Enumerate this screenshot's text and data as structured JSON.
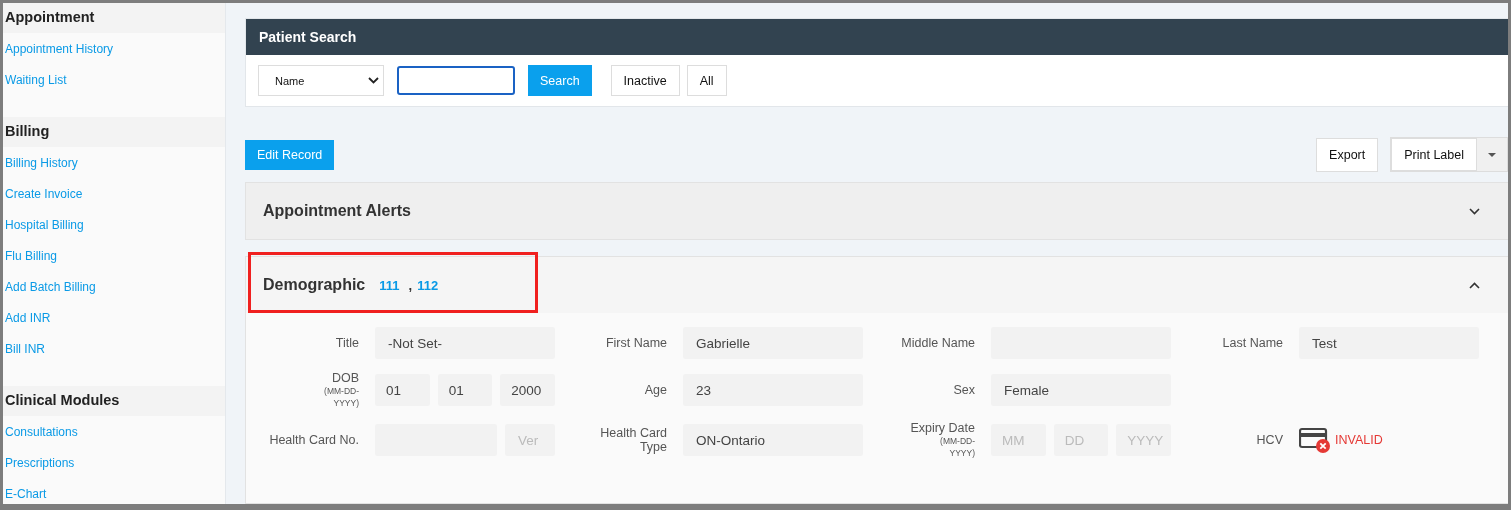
{
  "sidebar": {
    "sections": [
      {
        "title": "Appointment",
        "items": [
          {
            "label": "Appointment History"
          },
          {
            "label": "Waiting List"
          }
        ]
      },
      {
        "title": "Billing",
        "items": [
          {
            "label": "Billing History"
          },
          {
            "label": "Create Invoice"
          },
          {
            "label": "Hospital Billing"
          },
          {
            "label": "Flu Billing"
          },
          {
            "label": "Add Batch Billing"
          },
          {
            "label": "Add INR"
          },
          {
            "label": "Bill INR"
          }
        ]
      },
      {
        "title": "Clinical Modules",
        "items": [
          {
            "label": "Consultations"
          },
          {
            "label": "Prescriptions"
          },
          {
            "label": "E-Chart"
          }
        ]
      }
    ]
  },
  "patient_search": {
    "title": "Patient Search",
    "select": "Name",
    "input": {
      "focused": true
    },
    "buttons": [
      {
        "label": "Search",
        "kind": "primary"
      },
      {
        "label": "Inactive",
        "kind": "plain"
      },
      {
        "label": "All",
        "kind": "plain"
      }
    ]
  },
  "toolbar": {
    "edit": "Edit Record",
    "export": "Export",
    "print": "Print Label"
  },
  "appointment_alerts": {
    "title": "Appointment Alerts",
    "expanded": false
  },
  "demographic": {
    "title": "Demographic",
    "highlighted": true,
    "expanded": true,
    "links": [
      "111",
      "112"
    ],
    "separator": ",",
    "fields": [
      {
        "label": "Title",
        "kind": "text",
        "parts": [
          {
            "kind": "value",
            "text": "-Not Set-"
          }
        ]
      },
      {
        "label": "First Name",
        "kind": "text",
        "parts": [
          {
            "kind": "value",
            "text": "Gabrielle"
          }
        ]
      },
      {
        "label": "Middle Name",
        "kind": "text",
        "parts": [
          {
            "kind": "empty"
          }
        ]
      },
      {
        "label": "Last Name",
        "kind": "text",
        "parts": [
          {
            "kind": "value",
            "text": "Test"
          }
        ]
      },
      {
        "label": "DOB",
        "sublabel": "(MM-DD-YYYY)",
        "kind": "date",
        "parts": [
          {
            "kind": "value",
            "text": "01"
          },
          {
            "kind": "value",
            "text": "01"
          },
          {
            "kind": "value",
            "text": "2000"
          }
        ]
      },
      {
        "label": "Age",
        "kind": "text",
        "parts": [
          {
            "kind": "value",
            "text": "23"
          }
        ]
      },
      {
        "label": "Sex",
        "kind": "text",
        "parts": [
          {
            "kind": "value",
            "text": "Female"
          }
        ]
      },
      {
        "kind": "blank"
      },
      {
        "label": "Health Card No.",
        "kind": "card",
        "parts": [
          {
            "kind": "empty"
          },
          {
            "kind": "placeholder",
            "text": "Ver"
          }
        ]
      },
      {
        "label": "Health Card Type",
        "kind": "text",
        "parts": [
          {
            "kind": "value",
            "text": "ON-Ontario"
          }
        ]
      },
      {
        "label": "Expiry Date",
        "sublabel": "(MM-DD-YYYY)",
        "kind": "date",
        "parts": [
          {
            "kind": "placeholder",
            "text": "MM"
          },
          {
            "kind": "placeholder",
            "text": "DD"
          },
          {
            "kind": "placeholder",
            "text": "YYYY"
          }
        ]
      },
      {
        "label": "HCV",
        "kind": "status",
        "valid": false,
        "status": "INVALID"
      }
    ]
  }
}
